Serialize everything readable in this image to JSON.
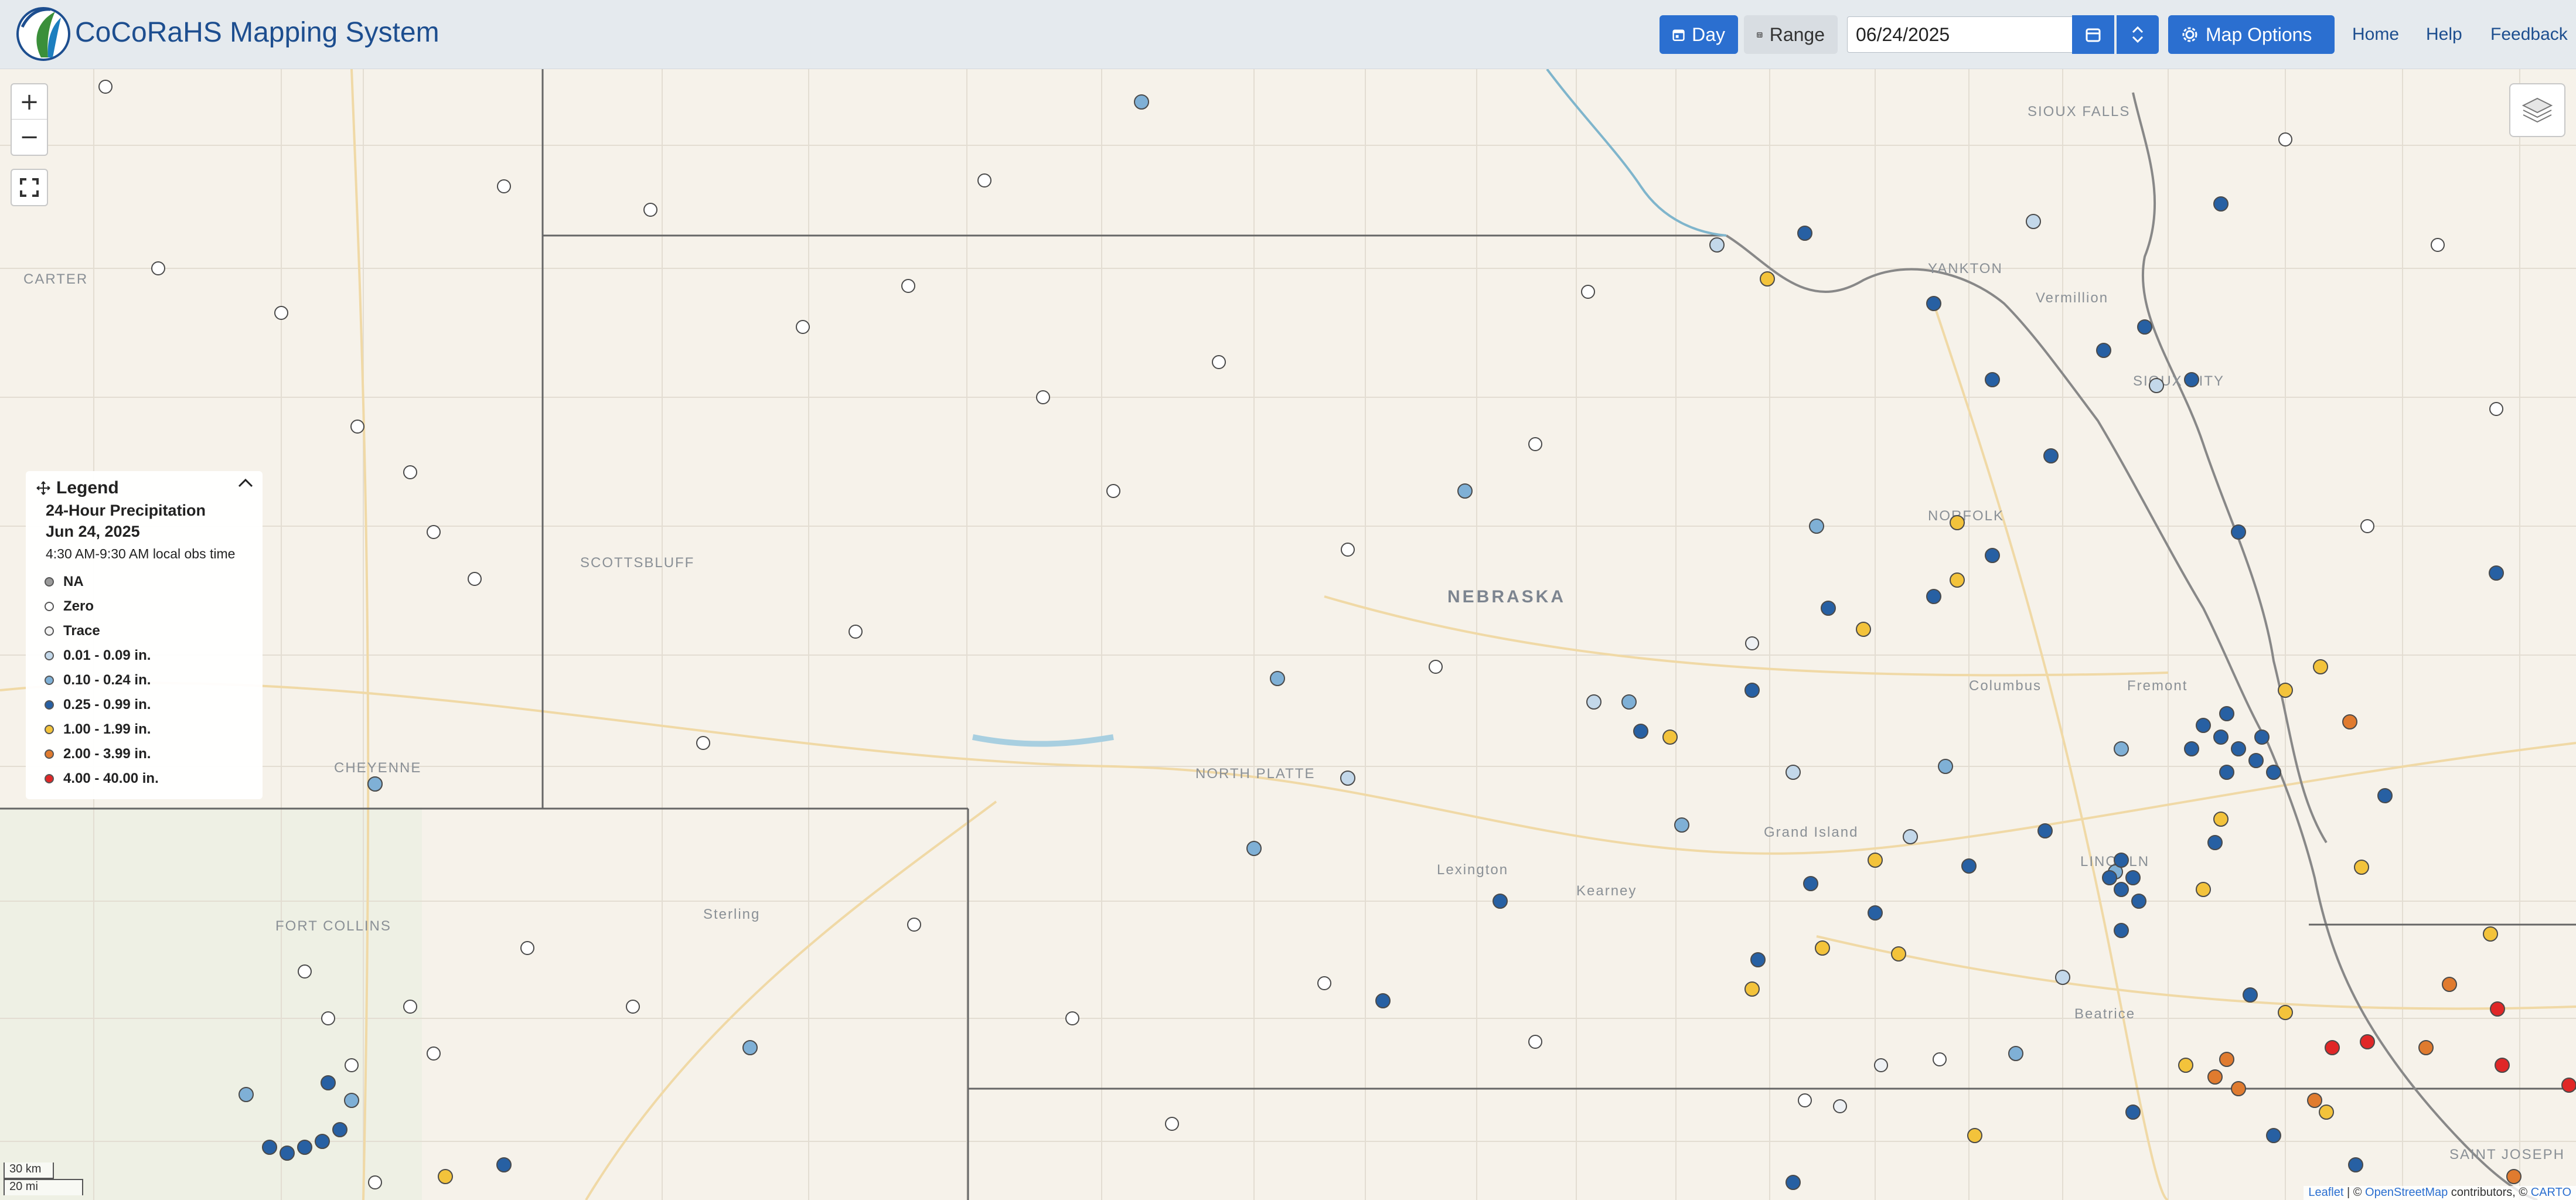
{
  "header": {
    "app_title": "CoCoRaHS Mapping System",
    "logo_text": "CoCoRaHS",
    "day_label": "Day",
    "range_label": "Range",
    "date_value": "06/24/2025",
    "map_options_label": "Map Options",
    "nav": {
      "home": "Home",
      "help": "Help",
      "feedback": "Feedback"
    }
  },
  "map_controls": {
    "zoom_in": "+",
    "zoom_out": "−"
  },
  "legend": {
    "heading": "Legend",
    "title": "24-Hour Precipitation",
    "date": "Jun 24, 2025",
    "obs_time": "4:30 AM-9:30 AM local obs time",
    "items": [
      {
        "label": "NA",
        "color": "#9a9a9a"
      },
      {
        "label": "Zero",
        "color": "#ffffff"
      },
      {
        "label": "Trace",
        "color": "#f2f2f2"
      },
      {
        "label": "0.01 - 0.09 in.",
        "color": "#c3d8ea"
      },
      {
        "label": "0.10 - 0.24 in.",
        "color": "#7fb0d6"
      },
      {
        "label": "0.25 - 0.99 in.",
        "color": "#2760a3"
      },
      {
        "label": "1.00 - 1.99 in.",
        "color": "#f3c33b"
      },
      {
        "label": "2.00 - 3.99 in.",
        "color": "#e07b2f"
      },
      {
        "label": "4.00 - 40.00 in.",
        "color": "#e02727"
      }
    ]
  },
  "map_labels": {
    "state": "NEBRASKA",
    "cities": [
      "SIOUX FALLS",
      "YANKTON",
      "Vermillion",
      "SIOUX CITY",
      "NORFOLK",
      "Columbus",
      "Fremont",
      "SCOTTSBLUFF",
      "NORTH PLATTE",
      "Lexington",
      "Kearney",
      "Grand Island",
      "LINCOLN",
      "Beatrice",
      "CHEYENNE",
      "FORT COLLINS",
      "Sterling",
      "CARTER",
      "SAINT JOSEPH"
    ]
  },
  "scale": {
    "metric": "30 km",
    "imperial": "20 mi"
  },
  "attribution": {
    "leaflet": "Leaflet",
    "sep1": " | © ",
    "osm": "OpenStreetMap",
    "contrib": " contributors, © ",
    "carto": "CARTO"
  }
}
